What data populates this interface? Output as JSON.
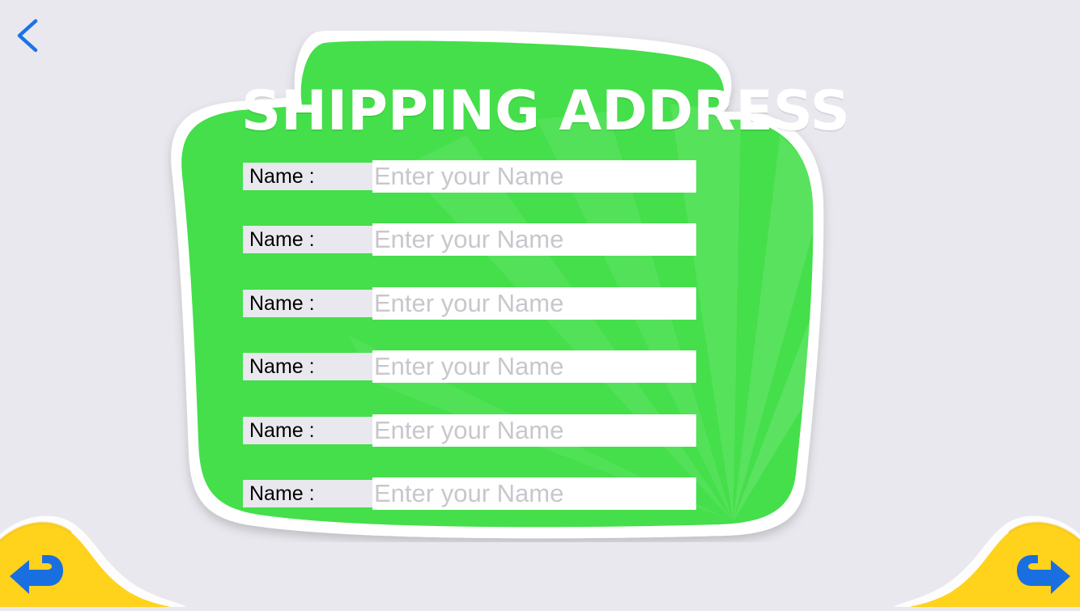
{
  "page": {
    "title": "SHIPPING ADDRESS"
  },
  "nav": {
    "back_icon": "chevron-left-icon",
    "back_color": "#1a73e8",
    "prev_icon": "curved-arrow-left-icon",
    "next_icon": "curved-arrow-right-icon"
  },
  "colors": {
    "background": "#e9e8ee",
    "board_green": "#44df4a",
    "corner_yellow": "#ffd21c",
    "arrow_blue": "#1a6fe0"
  },
  "form": {
    "fields": [
      {
        "label": "Name :",
        "placeholder": "Enter your Name",
        "value": ""
      },
      {
        "label": "Name :",
        "placeholder": "Enter your Name",
        "value": ""
      },
      {
        "label": "Name :",
        "placeholder": "Enter your Name",
        "value": ""
      },
      {
        "label": "Name :",
        "placeholder": "Enter your Name",
        "value": ""
      },
      {
        "label": "Name :",
        "placeholder": "Enter your Name",
        "value": ""
      },
      {
        "label": "Name :",
        "placeholder": "Enter your Name",
        "value": ""
      }
    ]
  }
}
